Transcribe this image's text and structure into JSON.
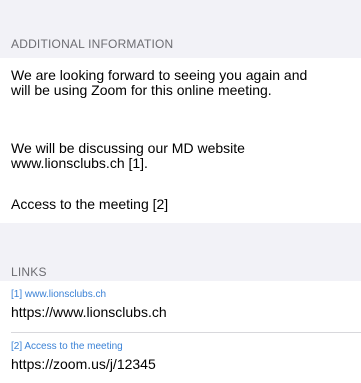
{
  "additional_info": {
    "header": "ADDITIONAL INFORMATION",
    "paragraphs": [
      "We are looking forward to seeing you again and will be using Zoom for this online meeting.",
      "We will be discussing our MD website www.lionsclubs.ch [1].",
      "Access to the meeting [2]"
    ]
  },
  "links": {
    "header": "LINKS",
    "items": [
      {
        "caption": "[1] www.lionsclubs.ch",
        "url": "https://www.lionsclubs.ch"
      },
      {
        "caption": "[2] Access to the meeting",
        "url": "https://zoom.us/j/12345"
      }
    ]
  },
  "colors": {
    "background": "#f2f2f7",
    "card": "#ffffff",
    "section_header": "#6d6d72",
    "link_caption": "#3b82d6",
    "divider": "#d8d8dc"
  }
}
